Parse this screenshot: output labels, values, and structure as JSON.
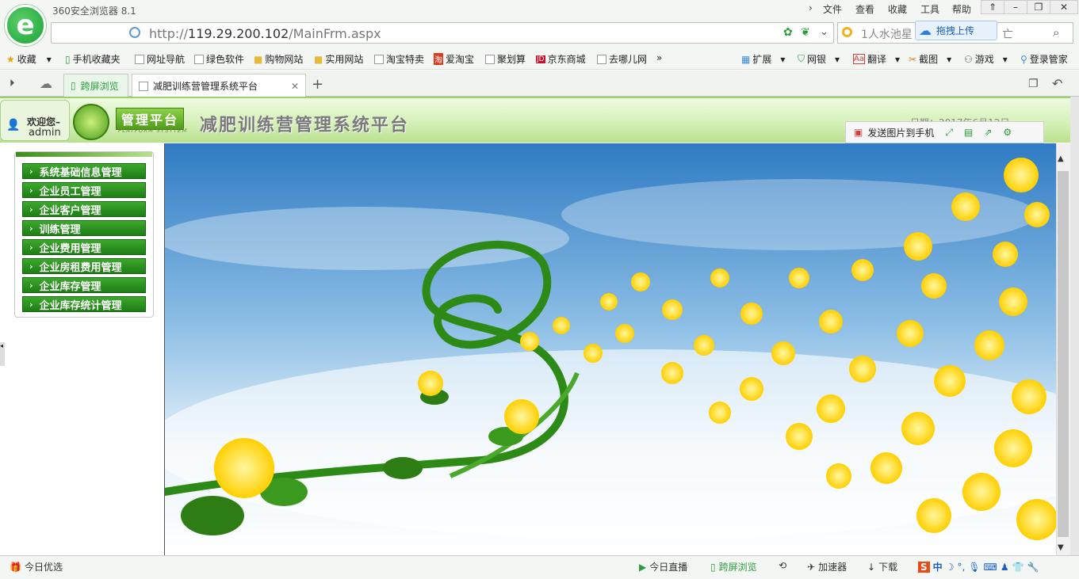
{
  "browser": {
    "app_name": "360安全浏览器 8.1",
    "menus": [
      "文件",
      "查看",
      "收藏",
      "工具",
      "帮助"
    ],
    "url_prefix": "http://",
    "url_host": "119.29.200.102",
    "url_path": "/MainFrm.aspx",
    "search_text": "1人水池星",
    "search_suffix": "亡",
    "upload_button": "拖拽上传",
    "bookmarks": [
      "收藏",
      "手机收藏夹",
      "网址导航",
      "绿色软件",
      "购物网站",
      "实用网站",
      "淘宝特卖",
      "爱淘宝",
      "聚划算",
      "京东商城",
      "去哪儿网"
    ],
    "bookmarks_right": [
      "扩展",
      "网银",
      "翻译",
      "截图",
      "游戏",
      "登录管家"
    ],
    "tabs": [
      {
        "label": "跨屏浏览"
      },
      {
        "label": "减肥训练营管理系统平台"
      }
    ]
  },
  "app": {
    "welcome": "欢迎您–",
    "user": "admin",
    "badge": "管理平台",
    "badge_sub": "PLATFORM SYSYTEM",
    "title": "减肥训练营管理系统平台",
    "date_partial": "日期：2017年6月12日",
    "send_to_phone": "发送图片到手机",
    "menu": [
      "系统基础信息管理",
      "企业员工管理",
      "企业客户管理",
      "训练管理",
      "企业费用管理",
      "企业房租费用管理",
      "企业库存管理",
      "企业库存统计管理"
    ]
  },
  "statusbar": {
    "left": "今日优选",
    "items": [
      "今日直播",
      "跨屏浏览",
      "加速器",
      "下载"
    ],
    "ime": "中"
  },
  "colors": {
    "accent": "#1d7d14",
    "sky": "#4a8fd0",
    "flower": "#ffd400"
  }
}
